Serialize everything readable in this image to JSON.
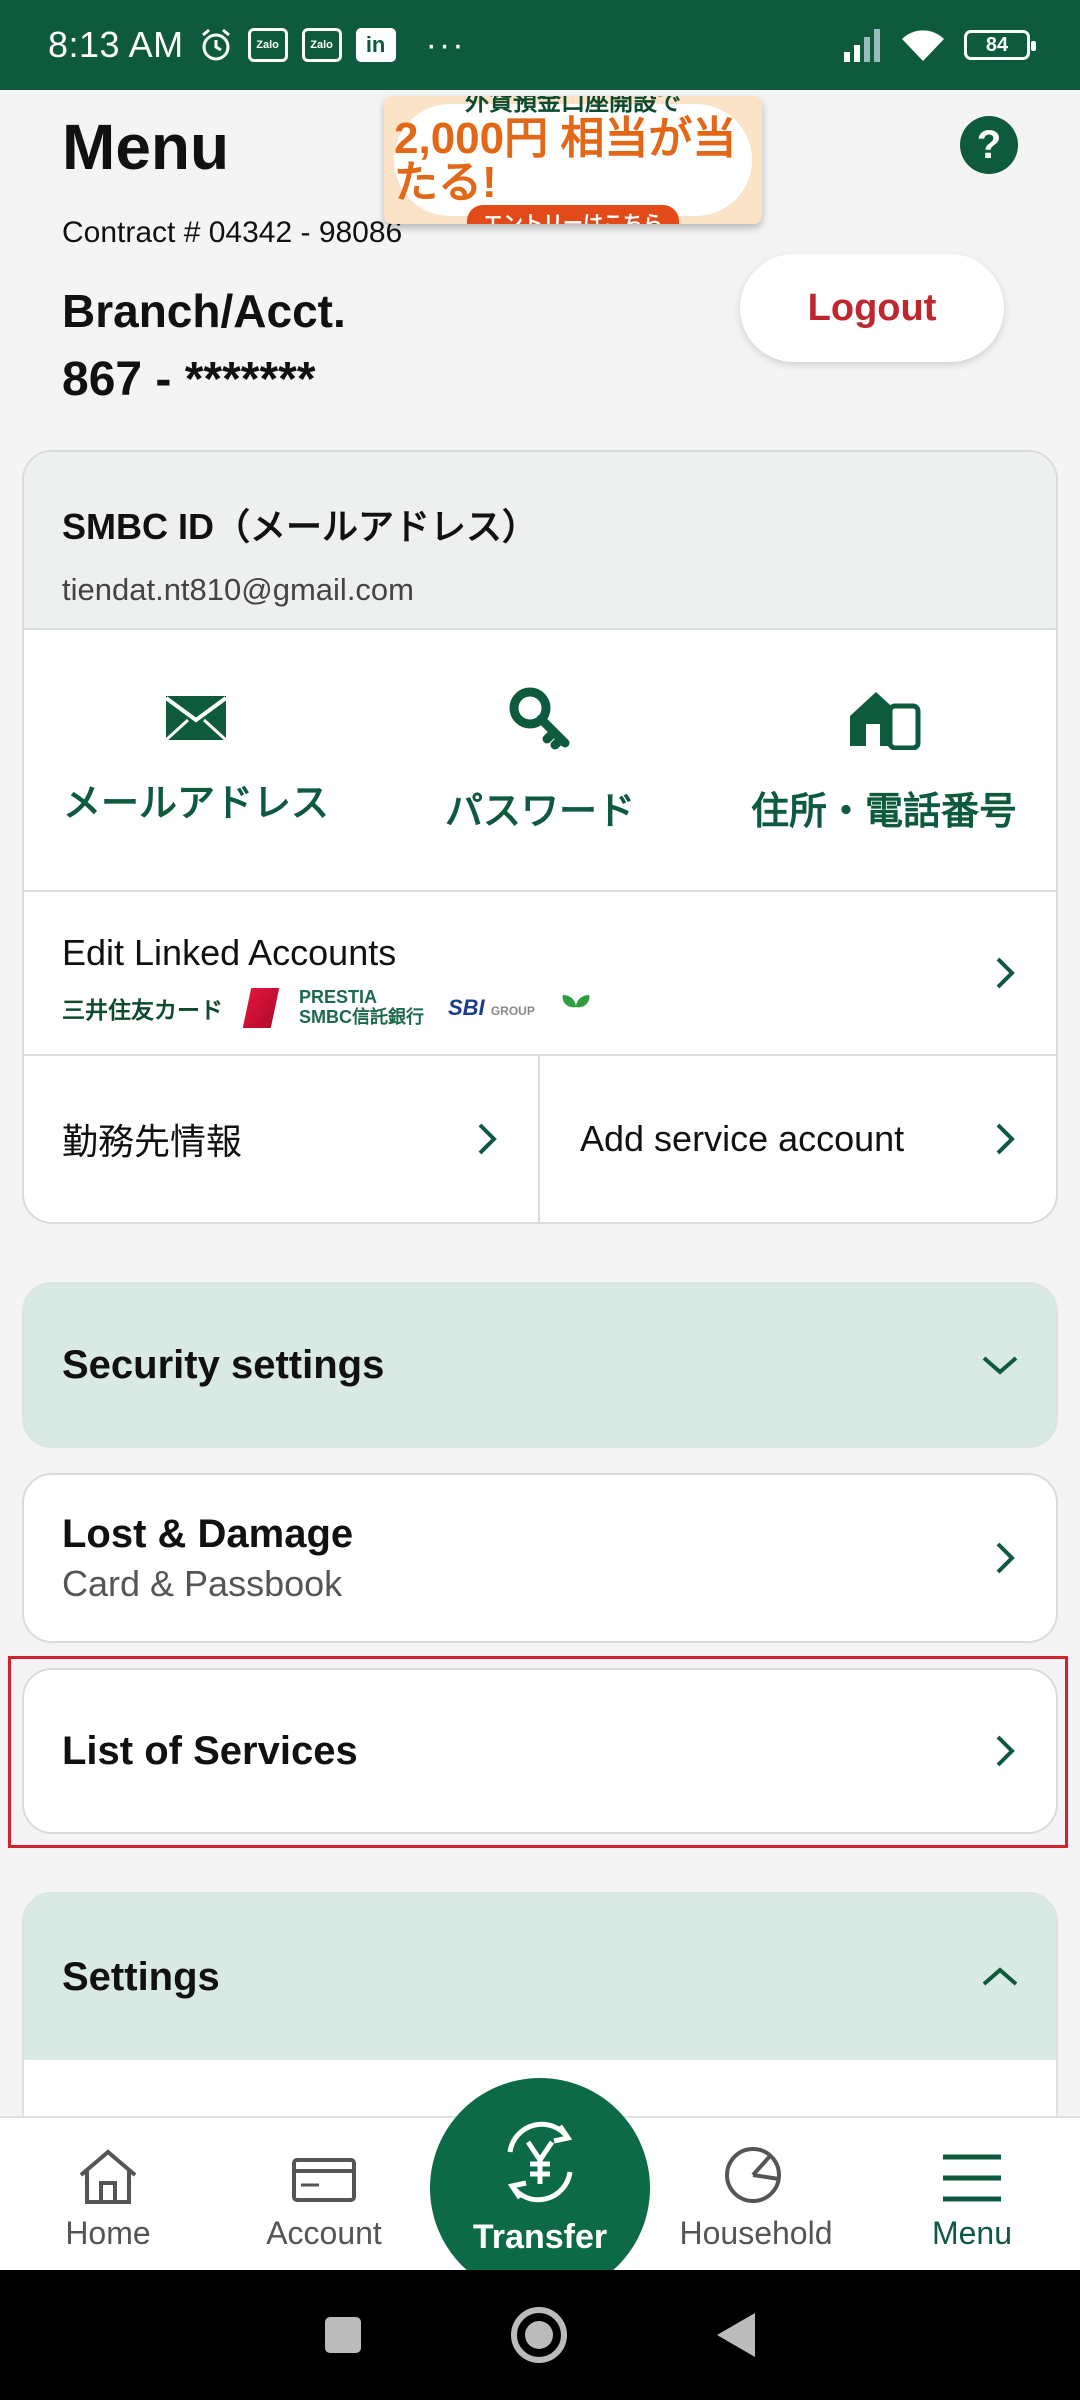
{
  "status_bar": {
    "time": "8:13 AM",
    "app_icons": [
      "Zalo",
      "Zalo",
      "in"
    ],
    "more": "···",
    "battery": "84"
  },
  "header": {
    "title": "Menu",
    "contract": "Contract #  04342 - 98086",
    "help": "?",
    "branch_label": "Branch/Acct.",
    "branch_number": "867 -  *******",
    "logout": "Logout"
  },
  "banner": {
    "line1": "外貨預金口座開設で",
    "line2": "2,000円 相当が当たる!",
    "line3": "エントリーはこちら"
  },
  "account": {
    "id_label": "SMBC ID（メールアドレス）",
    "email": "tiendat.nt810@gmail.com",
    "actions": [
      {
        "label": "メールアドレス",
        "icon": "mail-icon"
      },
      {
        "label": "パスワード",
        "icon": "key-icon"
      },
      {
        "label": "住所・電話番号",
        "icon": "home-phone-icon"
      }
    ],
    "linked": {
      "label": "Edit Linked Accounts",
      "logos": [
        "三井住友カード",
        "PRESTIA",
        "SMBC信託銀行",
        "SBI",
        "GROUP"
      ]
    },
    "workplace": "勤務先情報",
    "add_service": "Add service account"
  },
  "sections": {
    "security": "Security settings",
    "lost_title": "Lost & Damage",
    "lost_sub": "Card & Passbook",
    "services": "List of Services",
    "settings": "Settings"
  },
  "nav": {
    "home": "Home",
    "account": "Account",
    "transfer": "Transfer",
    "household": "Household",
    "menu": "Menu"
  },
  "colors": {
    "brand_green": "#0d5a3c",
    "section_green": "#d9e9e4",
    "logout_red": "#c0262d",
    "highlight_red": "#d42230"
  }
}
